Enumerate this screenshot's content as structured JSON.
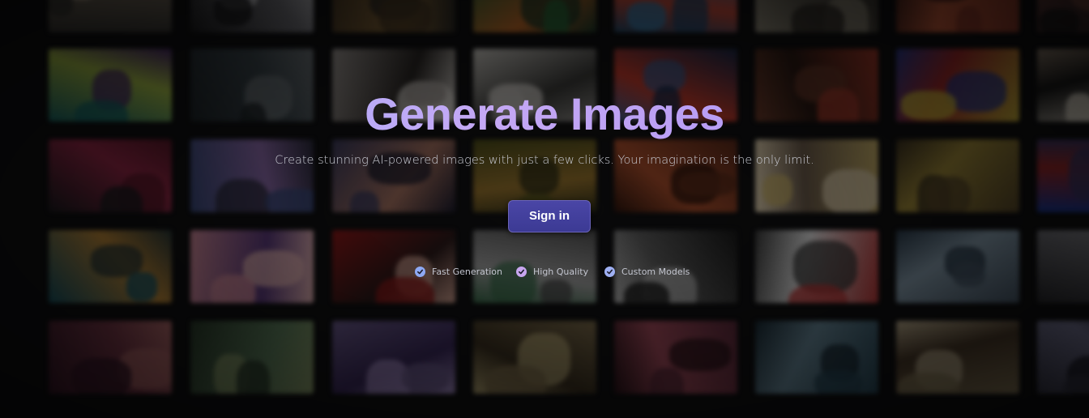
{
  "hero": {
    "title": "Generate Images",
    "subtitle": "Create stunning AI-powered images with just a few clicks. Your imagination is the only limit.",
    "signin_label": "Sign in"
  },
  "features": [
    {
      "label": "Fast Generation",
      "icon": "check-circle-icon",
      "color": "#8ea9f4"
    },
    {
      "label": "High Quality",
      "icon": "check-circle-icon",
      "color": "#c8a6ef"
    },
    {
      "label": "Custom Models",
      "icon": "check-circle-icon",
      "color": "#9fb0f3"
    }
  ],
  "colors": {
    "background": "#0b0b0c",
    "title_gradient_start": "#9fb2ff",
    "title_gradient_end": "#a98cf0",
    "button": "#423fa0"
  }
}
